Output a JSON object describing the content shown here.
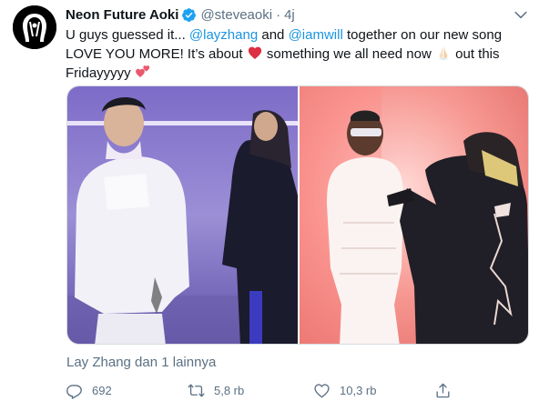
{
  "tweet": {
    "display_name": "Neon Future Aoki",
    "verified": true,
    "handle": "@steveaoki",
    "separator": "·",
    "time": "4j",
    "text": {
      "part1": "U guys guessed it... ",
      "mention1": "@layzhang",
      "part2": "  and ",
      "mention2": "@iamwill",
      "part3": " together on our new song",
      "part4": "LOVE YOU MORE! It’s about ",
      "part5": " something we all need now ",
      "part6": " out this",
      "part7": "Fridayyyyy "
    },
    "emojis": [
      "heart",
      "folded-hands",
      "two-hearts"
    ],
    "media_count": 2,
    "liked_by": "Lay Zhang dan 1 lainnya",
    "stats": {
      "replies": "692",
      "retweets": "5,8 rb",
      "likes": "10,3 rb"
    }
  },
  "colors": {
    "link": "#1b95e0",
    "secondary": "#5b7083",
    "verified": "#1da1f2",
    "heart": "#e0245e"
  }
}
